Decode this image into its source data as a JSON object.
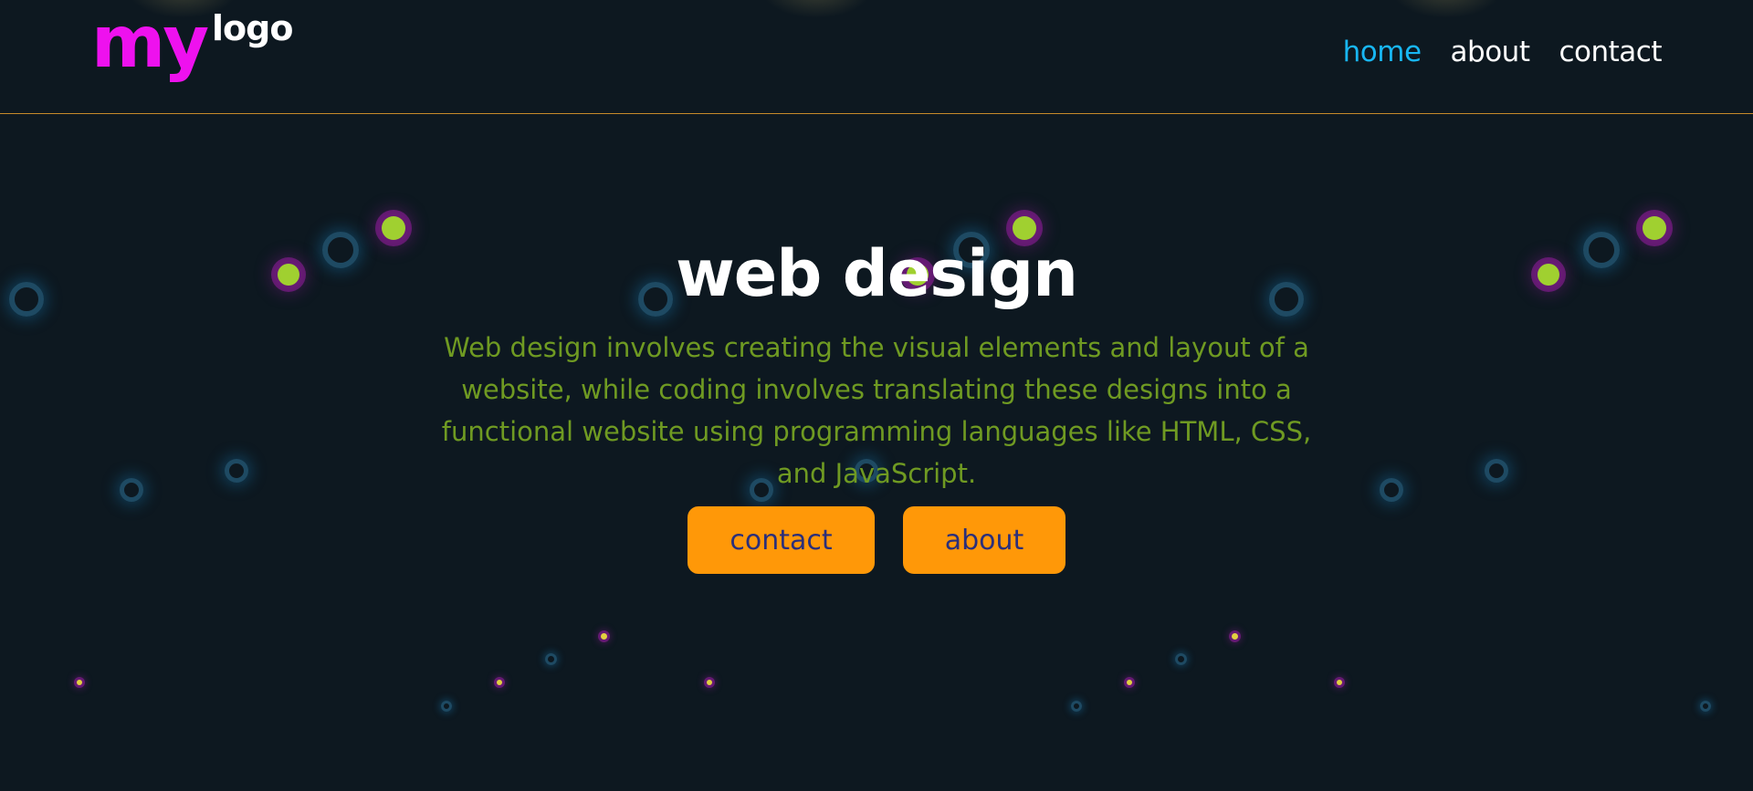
{
  "logo": {
    "my": "my",
    "logo": "logo"
  },
  "nav": {
    "items": [
      {
        "label": "home",
        "active": true
      },
      {
        "label": "about",
        "active": false
      },
      {
        "label": "contact",
        "active": false
      }
    ]
  },
  "hero": {
    "title": "web design",
    "description": "Web design involves creating the visual elements and layout of a website, while coding involves translating these designs into a functional website using programming languages like HTML, CSS, and JavaScript.",
    "buttons": {
      "contact": "contact",
      "about": "about"
    }
  },
  "colors": {
    "background": "#0d1820",
    "logo_accent": "#ee11ee",
    "nav_active": "#18b6f2",
    "description_text": "#6f9a22",
    "button_bg": "#ff9808",
    "button_text": "#2b2f7a",
    "header_divider": "#c58a2a"
  }
}
